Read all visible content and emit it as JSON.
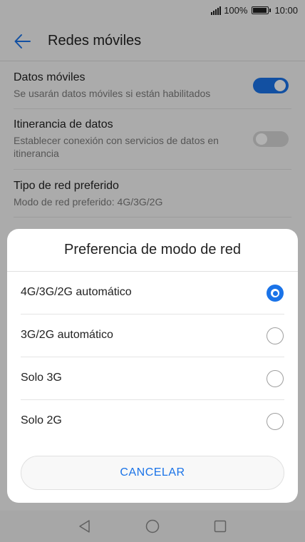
{
  "status_bar": {
    "battery": "100%",
    "time": "10:00",
    "battery_level": 1.0
  },
  "header": {
    "title": "Redes móviles"
  },
  "settings": [
    {
      "title": "Datos móviles",
      "subtitle": "Se usarán datos móviles si están habilitados",
      "toggle": "on"
    },
    {
      "title": "Itinerancia de datos",
      "subtitle": "Establecer conexión con servicios de datos en itinerancia",
      "toggle": "off"
    },
    {
      "title": "Tipo de red preferido",
      "subtitle": "Modo de red preferido: 4G/3G/2G"
    }
  ],
  "dialog": {
    "title": "Preferencia de modo de red",
    "options": [
      {
        "label": "4G/3G/2G automático",
        "selected": true
      },
      {
        "label": "3G/2G automático",
        "selected": false
      },
      {
        "label": "Solo 3G",
        "selected": false
      },
      {
        "label": "Solo 2G",
        "selected": false
      }
    ],
    "cancel_label": "CANCELAR"
  },
  "colors": {
    "accent": "#1a73e8",
    "toggle_off": "#d6d6d6"
  },
  "navbar": {
    "icons": [
      "back-triangle-icon",
      "home-circle-icon",
      "recents-square-icon"
    ]
  }
}
